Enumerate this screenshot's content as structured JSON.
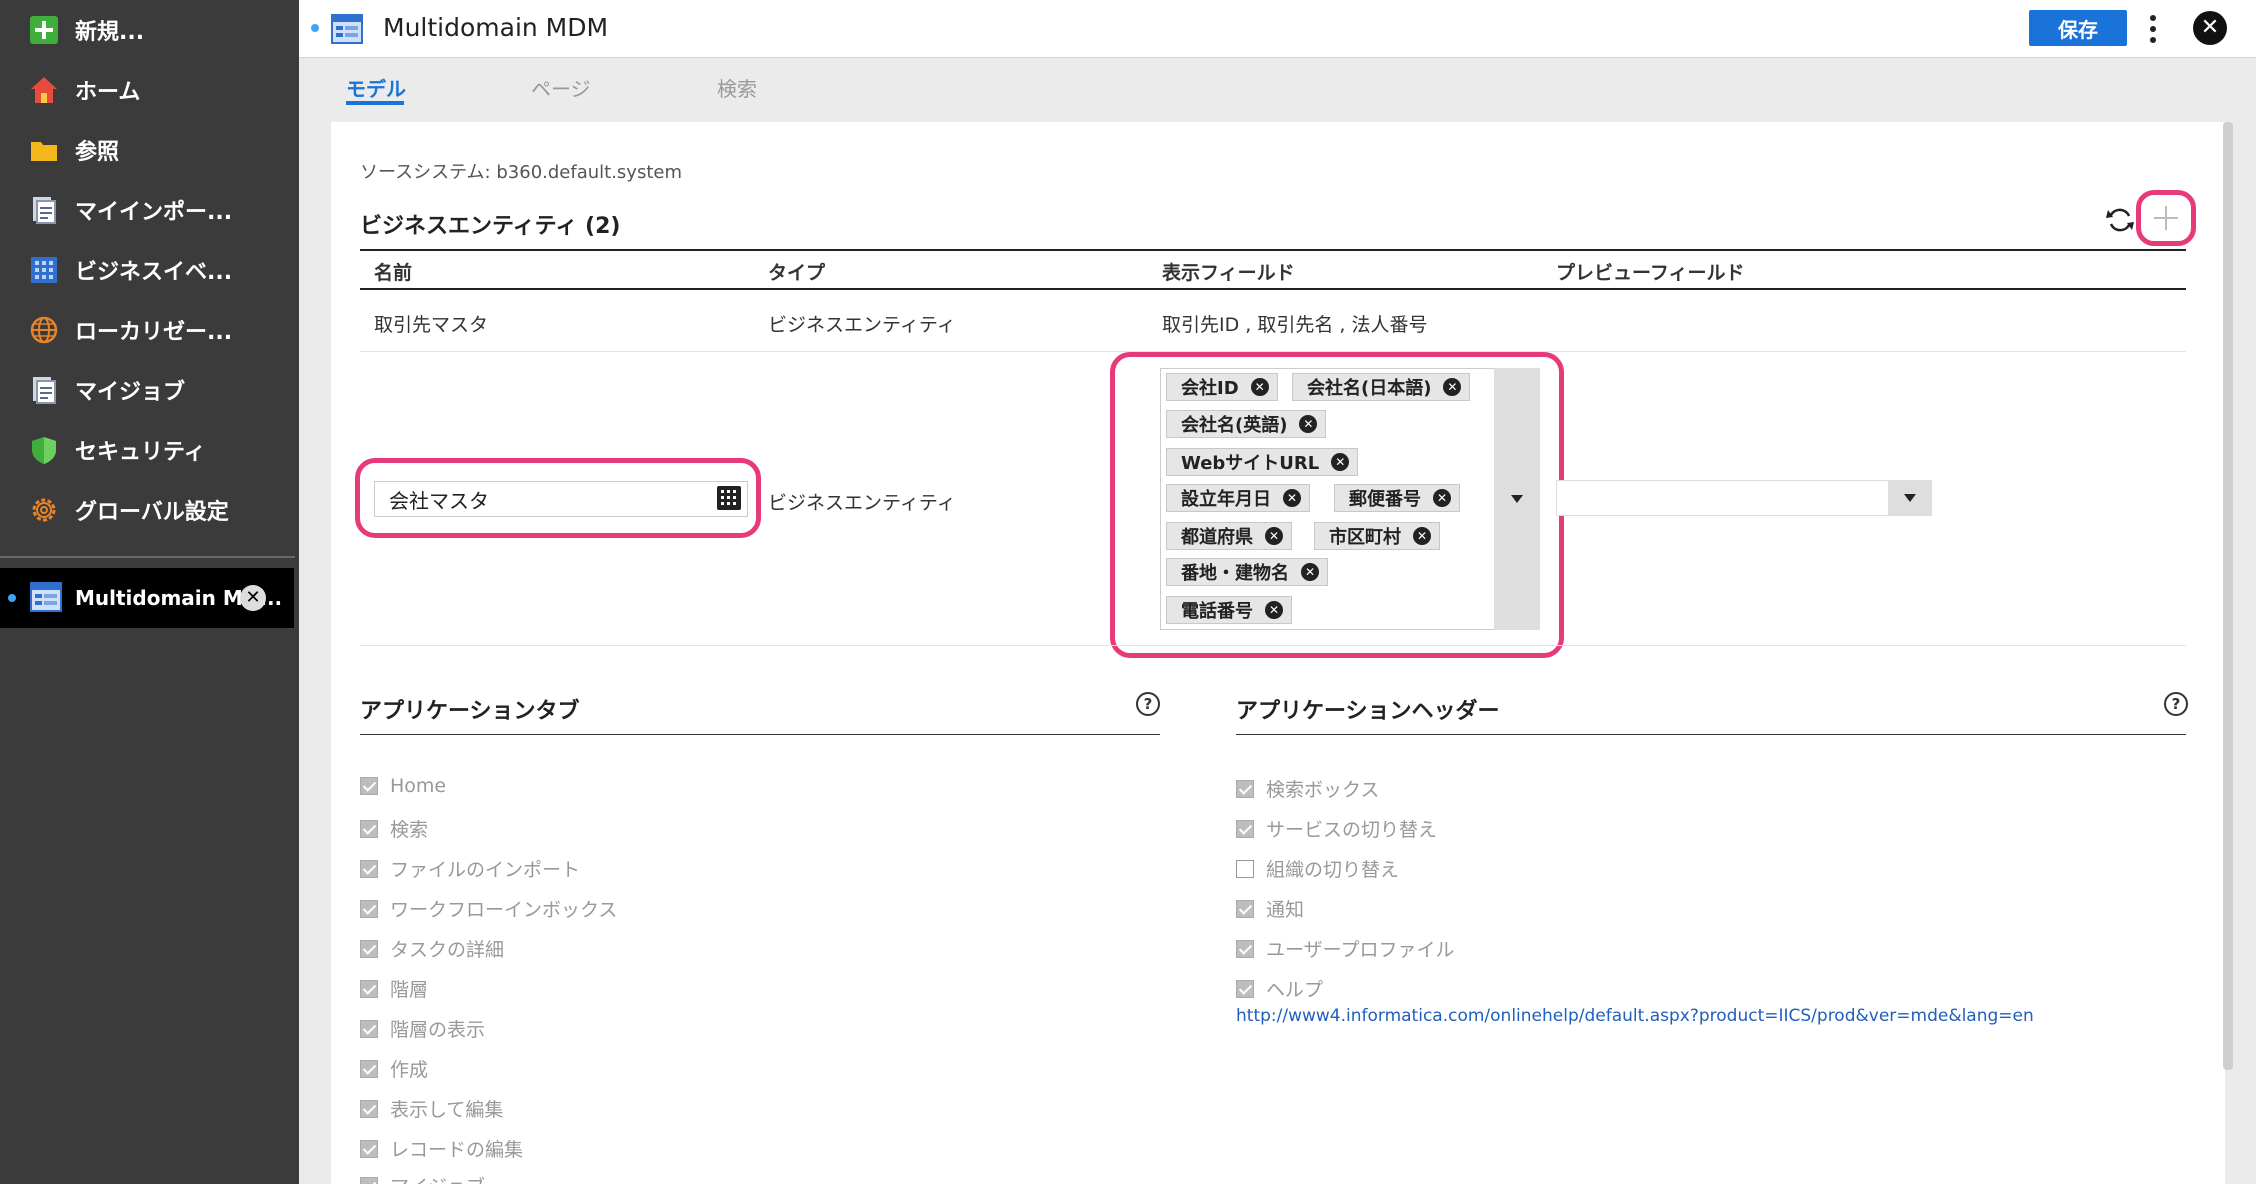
{
  "sidebar": {
    "items": [
      {
        "label": "新規...",
        "icon": "plus-icon"
      },
      {
        "label": "ホーム",
        "icon": "home-icon"
      },
      {
        "label": "参照",
        "icon": "folder-icon"
      },
      {
        "label": "マイインポー...",
        "icon": "document-icon"
      },
      {
        "label": "ビジネスイベ...",
        "icon": "grid-icon"
      },
      {
        "label": "ローカリゼー...",
        "icon": "globe-icon"
      },
      {
        "label": "マイジョブ",
        "icon": "document-icon"
      },
      {
        "label": "セキュリティ",
        "icon": "shield-icon"
      },
      {
        "label": "グローバル設定",
        "icon": "gear-icon"
      }
    ],
    "open_tab": {
      "label": "Multidomain MD...",
      "icon": "app-icon"
    }
  },
  "topbar": {
    "title": "Multidomain MDM",
    "save_label": "保存"
  },
  "subtabs": [
    "モデル",
    "ページ",
    "検索"
  ],
  "source": {
    "label": "ソースシステム:",
    "value": "b360.default.system"
  },
  "business_entities": {
    "title": "ビジネスエンティティ (2)",
    "columns": [
      "名前",
      "タイプ",
      "表示フィールド",
      "プレビューフィールド"
    ],
    "rows": [
      {
        "name": "取引先マスタ",
        "type": "ビジネスエンティティ",
        "display": "取引先ID , 取引先名 , 法人番号"
      },
      {
        "name": "会社マスタ",
        "type": "ビジネスエンティティ"
      }
    ],
    "chips": [
      "会社ID",
      "会社名(日本語)",
      "会社名(英語)",
      "WebサイトURL",
      "設立年月日",
      "郵便番号",
      "都道府県",
      "市区町村",
      "番地・建物名",
      "電話番号"
    ]
  },
  "app_tabs": {
    "title": "アプリケーションタブ",
    "items": [
      "Home",
      "検索",
      "ファイルのインポート",
      "ワークフローインボックス",
      "タスクの詳細",
      "階層",
      "階層の表示",
      "作成",
      "表示して編集",
      "レコードの編集",
      "マイジョブ"
    ]
  },
  "app_header": {
    "title": "アプリケーションヘッダー",
    "items": [
      {
        "label": "検索ボックス",
        "checked": true
      },
      {
        "label": "サービスの切り替え",
        "checked": true
      },
      {
        "label": "組織の切り替え",
        "checked": false
      },
      {
        "label": "通知",
        "checked": true
      },
      {
        "label": "ユーザープロファイル",
        "checked": true
      },
      {
        "label": "ヘルプ",
        "checked": true
      }
    ],
    "help_url": "http://www4.informatica.com/onlinehelp/default.aspx?product=IICS/prod&ver=mde&lang=en"
  },
  "colors": {
    "accent": "#1a73d9",
    "highlight": "#e63a7a",
    "sidebar": "#3b3b3b"
  }
}
